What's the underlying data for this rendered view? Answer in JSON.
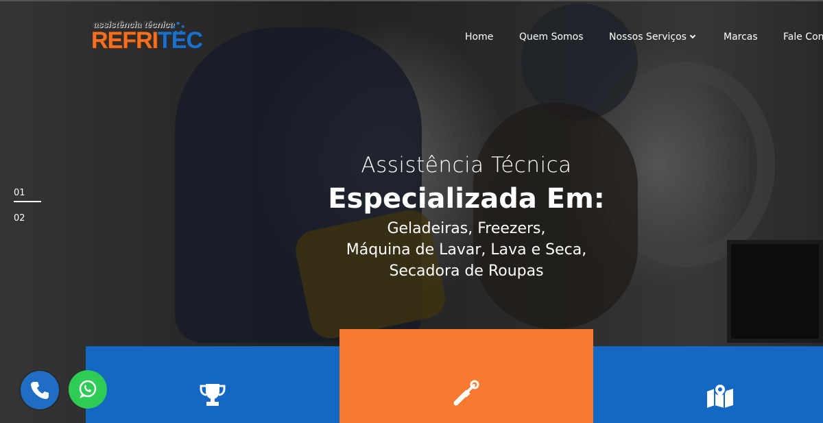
{
  "brand": {
    "tagline": "assistência técnica",
    "name_part1": "REFRI",
    "name_part2": "TEC"
  },
  "nav": {
    "items": [
      {
        "label": "Home"
      },
      {
        "label": "Quem Somos"
      },
      {
        "label": "Nossos Serviços",
        "has_dropdown": true
      },
      {
        "label": "Marcas"
      },
      {
        "label": "Fale Con"
      }
    ]
  },
  "slider": {
    "indicators": [
      "01",
      "02"
    ],
    "active_index": 0
  },
  "hero": {
    "line1": "Assistência Técnica",
    "line2": "Especializada Em:",
    "line3": "Geladeiras, Freezers,",
    "line4": "Máquina de Lavar, Lava e Seca,",
    "line5": "Secadora de Roupas"
  },
  "features": [
    {
      "icon": "trophy-icon",
      "color": "#1368c3"
    },
    {
      "icon": "tools-icon",
      "color": "#f57a30"
    },
    {
      "icon": "map-icon",
      "color": "#1368c3"
    }
  ],
  "floating": {
    "phone_icon": "phone-icon",
    "whatsapp_icon": "whatsapp-icon",
    "phone_color": "#1f6ec3",
    "whatsapp_color": "#2ecc55"
  },
  "colors": {
    "brand_orange": "#f36f21",
    "brand_blue": "#1e6fc8"
  }
}
